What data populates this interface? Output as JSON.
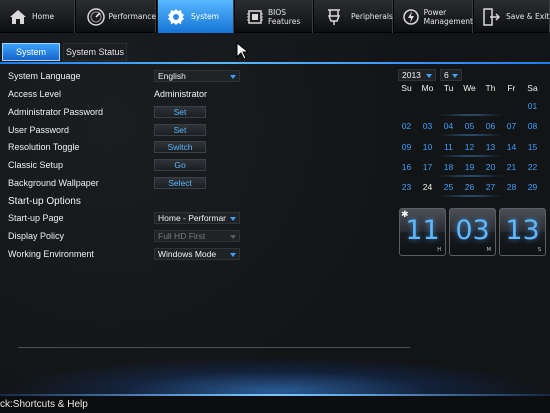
{
  "nav": {
    "items": [
      {
        "label": "Home",
        "icon": "home-icon"
      },
      {
        "label": "Performance",
        "icon": "gauge-icon"
      },
      {
        "label": "System",
        "icon": "gear-icon",
        "active": true
      },
      {
        "label": "BIOS\nFeatures",
        "icon": "chip-icon"
      },
      {
        "label": "Peripherals",
        "icon": "plug-icon"
      },
      {
        "label": "Power\nManagement",
        "icon": "power-icon"
      },
      {
        "label": "Save & Exit",
        "icon": "exit-icon"
      }
    ]
  },
  "tabs": {
    "system": "System",
    "status": "System Status"
  },
  "settings": {
    "language": {
      "label": "System Language",
      "value": "English"
    },
    "access": {
      "label": "Access Level",
      "value": "Administrator"
    },
    "admin_pw": {
      "label": "Administrator Password",
      "button": "Set"
    },
    "user_pw": {
      "label": "User Password",
      "button": "Set"
    },
    "resolution": {
      "label": "Resolution Toggle",
      "button": "Switch"
    },
    "classic": {
      "label": "Classic Setup",
      "button": "Go"
    },
    "wallpaper": {
      "label": "Background Wallpaper",
      "button": "Select"
    },
    "startup_header": "Start-up Options",
    "startup_page": {
      "label": "Start-up Page",
      "value": "Home - Performar"
    },
    "display_policy": {
      "label": "Display Policy",
      "value": "Full HD First"
    },
    "work_env": {
      "label": "Working Environment",
      "value": "Windows Mode"
    }
  },
  "calendar": {
    "year": "2013",
    "month": "6",
    "headers": [
      "Su",
      "Mo",
      "Tu",
      "We",
      "Th",
      "Fr",
      "Sa"
    ],
    "days": [
      "",
      "",
      "",
      "",
      "",
      "",
      "01",
      "02",
      "03",
      "04",
      "05",
      "06",
      "07",
      "08",
      "09",
      "10",
      "11",
      "12",
      "13",
      "14",
      "15",
      "16",
      "17",
      "18",
      "19",
      "20",
      "21",
      "22",
      "23",
      "24",
      "25",
      "26",
      "27",
      "28",
      "29"
    ],
    "today": "24"
  },
  "clock": {
    "hours": "11",
    "minutes": "03",
    "seconds": "13",
    "h_unit": "H",
    "m_unit": "M",
    "s_unit": "S"
  },
  "status": {
    "text": "ck:Shortcuts & Help"
  },
  "colors": {
    "accent": "#3aa2ff",
    "active_tab": "#1574d6"
  }
}
